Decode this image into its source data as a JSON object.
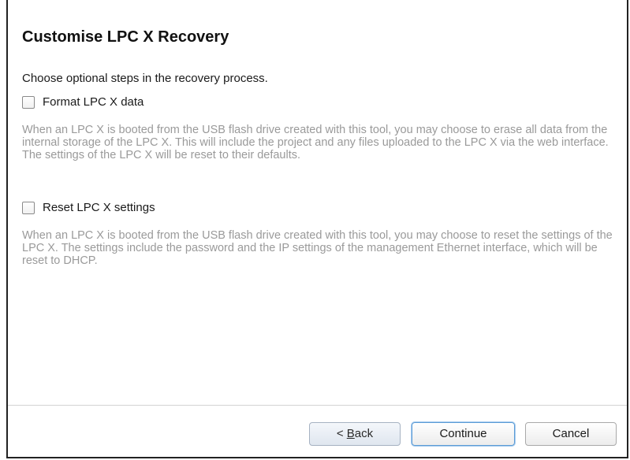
{
  "dialog": {
    "title": "Customise LPC X Recovery",
    "intro": "Choose optional steps in the recovery process."
  },
  "options": [
    {
      "label": "Format LPC X data",
      "checked": false,
      "description": "When an LPC X is booted from the USB flash drive created with this tool, you may choose to erase all data from the internal storage of the LPC X. This will include the project and any files uploaded to the LPC X via the web interface. The settings of the LPC X will be reset to their defaults."
    },
    {
      "label": "Reset LPC X settings",
      "checked": false,
      "description": "When an LPC X is booted from the USB flash drive created with this tool, you may choose to reset the settings of the LPC X. The settings include the password and the IP settings of the management Ethernet interface, which will be reset to DHCP."
    }
  ],
  "buttons": {
    "back_prefix": "< ",
    "back_mnemonic": "B",
    "back_rest": "ack",
    "continue": "Continue",
    "cancel": "Cancel"
  },
  "colors": {
    "description_text": "#9a9a9a",
    "default_button_border": "#5b9bd5"
  }
}
